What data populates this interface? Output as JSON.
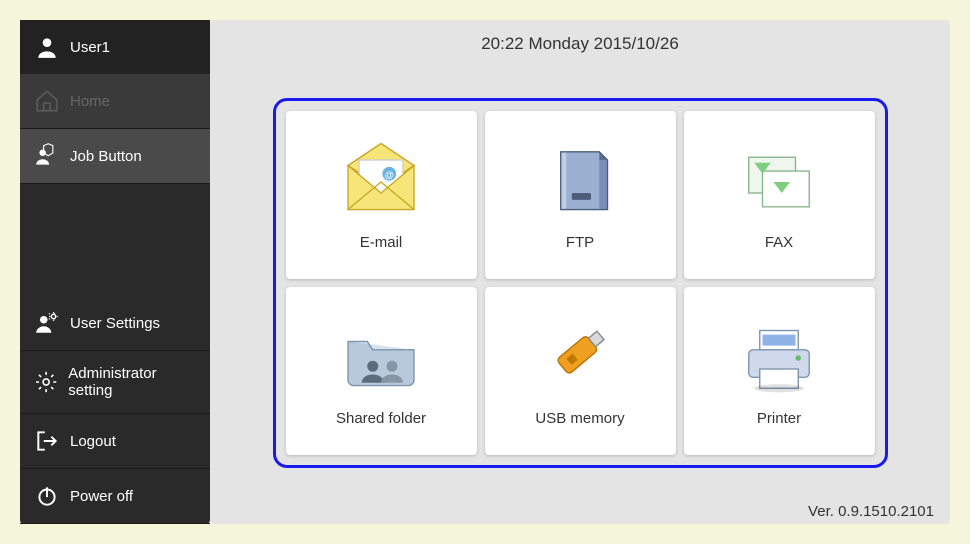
{
  "sidebar": {
    "user": "User1",
    "home": "Home",
    "job_button": "Job Button",
    "user_settings": "User Settings",
    "admin_setting": "Administrator setting",
    "logout": "Logout",
    "power_off": "Power off"
  },
  "header": {
    "datetime": "20:22 Monday 2015/10/26"
  },
  "tiles": {
    "email": "E-mail",
    "ftp": "FTP",
    "fax": "FAX",
    "shared": "Shared folder",
    "usb": "USB memory",
    "printer": "Printer"
  },
  "footer": {
    "version": "Ver. 0.9.1510.2101"
  }
}
